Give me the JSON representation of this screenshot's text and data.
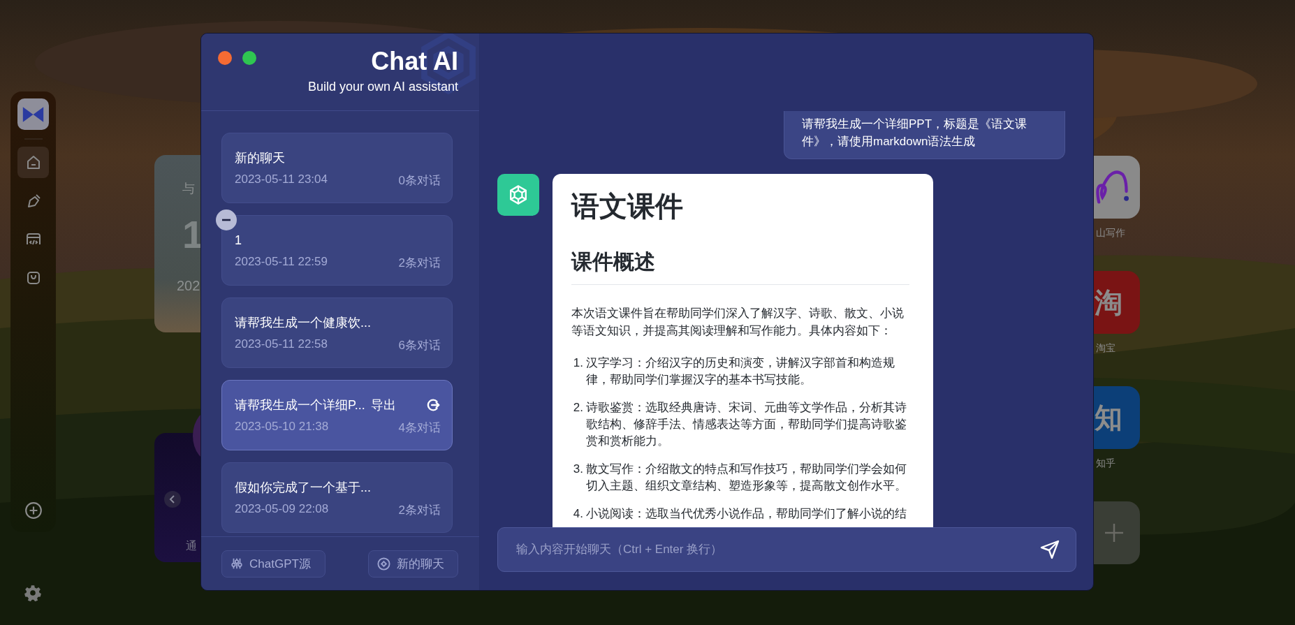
{
  "dock": {
    "items": [
      {
        "selected": true
      },
      {
        "selected": false
      },
      {
        "selected": false
      },
      {
        "selected": false
      }
    ]
  },
  "widgets_left": [
    {
      "kind": "stat",
      "lines": [
        "与",
        "1",
        "202"
      ]
    },
    {
      "kind": "media",
      "text": "通"
    }
  ],
  "apps_right": [
    {
      "kind": "squiggle",
      "label": "山写作"
    },
    {
      "kind": "glyph",
      "glyph": "淘",
      "color": "#7a1414",
      "label": "淘宝"
    },
    {
      "kind": "glyph",
      "glyph": "知",
      "color": "#0c3f78",
      "label": "知乎"
    },
    {
      "kind": "add"
    }
  ],
  "window": {
    "title": "Chat AI",
    "subtitle": "Build your own AI assistant"
  },
  "chats": [
    {
      "title": "新的聊天",
      "time": "2023-05-11 23:04",
      "count": "0条对话",
      "selected": false,
      "show_delete": false
    },
    {
      "title": "1",
      "time": "2023-05-11 22:59",
      "count": "2条对话",
      "selected": false,
      "show_delete": true
    },
    {
      "title": "请帮我生成一个健康饮...",
      "time": "2023-05-11 22:58",
      "count": "6条对话",
      "selected": false,
      "show_delete": false
    },
    {
      "title": "请帮我生成一个详细P...",
      "time": "2023-05-10 21:38",
      "count": "4条对话",
      "selected": true,
      "show_delete": false,
      "export_label": "导出"
    },
    {
      "title": "假如你完成了一个基于...",
      "time": "2023-05-09 22:08",
      "count": "2条对话",
      "selected": false,
      "show_delete": false
    }
  ],
  "footer_buttons": [
    {
      "kind": "source",
      "label": "ChatGPT源"
    },
    {
      "kind": "new",
      "label": "新的聊天"
    }
  ],
  "messages": [
    {
      "kind": "user",
      "text": "请帮我生成一个详细PPT，标题是《语文课件》，请使用markdown语法生成"
    },
    {
      "kind": "assistant",
      "blocks": [
        {
          "kind": "h1",
          "text": "语文课件"
        },
        {
          "kind": "h2",
          "text": "课件概述"
        },
        {
          "kind": "p",
          "text": "本次语文课件旨在帮助同学们深入了解汉字、诗歌、散文、小说等语文知识，并提高其阅读理解和写作能力。具体内容如下："
        },
        {
          "kind": "ol",
          "items": [
            {
              "number": "1.",
              "text": "汉字学习：介绍汉字的历史和演变，讲解汉字部首和构造规律，帮助同学们掌握汉字的基本书写技能。"
            },
            {
              "number": "2.",
              "text": "诗歌鉴赏：选取经典唐诗、宋词、元曲等文学作品，分析其诗歌结构、修辞手法、情感表达等方面，帮助同学们提高诗歌鉴赏和赏析能力。"
            },
            {
              "number": "3.",
              "text": "散文写作：介绍散文的特点和写作技巧，帮助同学们学会如何切入主题、组织文章结构、塑造形象等，提高散文创作水平。"
            },
            {
              "number": "4.",
              "text": "小说阅读：选取当代优秀小说作品，帮助同学们了解小说的结"
            }
          ]
        }
      ]
    }
  ],
  "composer": {
    "placeholder": "输入内容开始聊天（Ctrl + Enter 换行）"
  }
}
